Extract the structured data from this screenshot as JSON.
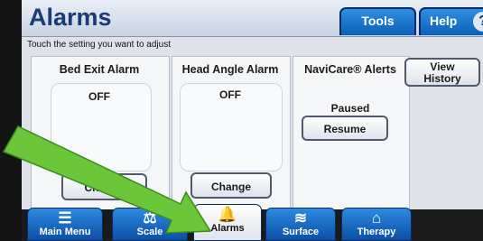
{
  "header": {
    "title": "Alarms",
    "tools_tab": "Tools",
    "help_tab": "Help",
    "help_glyph": "?"
  },
  "instruction": "Touch the setting you want to adjust",
  "columns": {
    "bed_exit": {
      "label": "Bed Exit Alarm",
      "state": "OFF",
      "button": "Change"
    },
    "head_angle": {
      "label": "Head Angle Alarm",
      "state": "OFF",
      "button": "Change"
    },
    "navicare": {
      "label": "NaviCare® Alerts",
      "state": "Paused",
      "button": "Resume"
    }
  },
  "view_history": {
    "line1": "View",
    "line2": "History"
  },
  "nav": [
    {
      "label": "Main Menu",
      "icon": "menu-icon",
      "glyph": "☰"
    },
    {
      "label": "Scale",
      "icon": "scale-icon",
      "glyph": "⚖"
    },
    {
      "label": "Alarms",
      "icon": "bell-icon",
      "glyph": "🔔"
    },
    {
      "label": "Surface",
      "icon": "surface-icon",
      "glyph": "≋"
    },
    {
      "label": "Therapy",
      "icon": "therapy-icon",
      "glyph": "⌂"
    }
  ],
  "colors": {
    "accent": "#0b5fb8",
    "arrow": "#6cc63a",
    "title": "#1a3a78"
  }
}
